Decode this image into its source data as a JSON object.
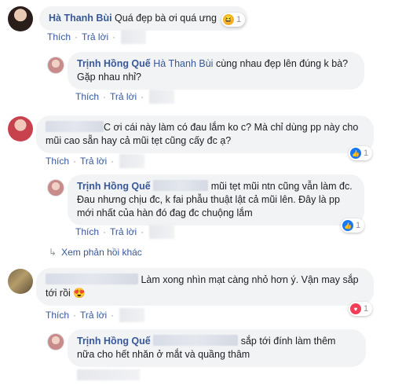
{
  "actions": {
    "like": "Thích",
    "reply": "Trả lời",
    "sep": "·"
  },
  "comments": [
    {
      "name": "Hà Thanh Bùi",
      "text": "Quá đẹp bà ơi quá ưng",
      "reaction": {
        "type": "haha",
        "count": "1"
      },
      "reply": {
        "name": "Trịnh Hồng Quế",
        "mention": "Hà Thanh Bùi",
        "line1": "cùng nhau đẹp lên đúng k bà?",
        "line2": "Gặp nhau nhỉ?"
      }
    },
    {
      "line1": "C ơi cái này làm có đau lắm ko c? Mà chỉ dùng pp này cho",
      "line2": "mũi cao sẵn hay cả mũi tẹt cũng cấy đc ạ?",
      "reaction": {
        "type": "like",
        "count": "1"
      },
      "reply": {
        "name": "Trịnh Hồng Quế",
        "line1": "mũi tẹt mũi ntn cũng vẫn làm đc.",
        "line2": "Đau nhưng chịu đc, k fai phẫu thuật lật cả mũi lên. Đây là pp",
        "line3": "mới nhất của hàn đó đag đc chuộng lắm",
        "reaction": {
          "type": "like",
          "count": "1"
        }
      }
    },
    {
      "line1": "Làm xong nhìn mạt càng nhỏ hơn ý. Vận may sắp",
      "line2": "tới rồi",
      "reaction": {
        "type": "love",
        "count": "1"
      },
      "reply": {
        "name": "Trịnh Hồng Quế",
        "line1": "sắp tới đính làm thêm",
        "line2": "nữa cho hết nhăn ở mắt và quầng thâm"
      }
    }
  ],
  "view_more": "Xem phản hồi khác",
  "icons": {
    "reply_arrow": "↳",
    "like": "👍",
    "love": "♥",
    "haha": "😆",
    "heart_eyes": "😍"
  },
  "colors": {
    "link": "#385898",
    "bubble": "#f2f3f5",
    "like": "#1877f2",
    "love": "#f33e58"
  }
}
